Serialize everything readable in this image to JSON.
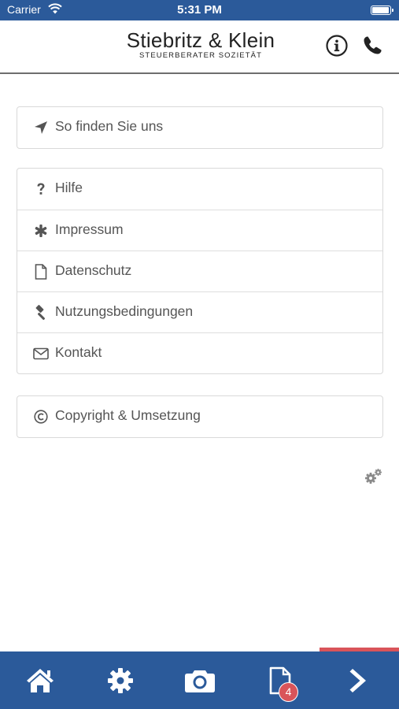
{
  "status_bar": {
    "carrier": "Carrier",
    "time": "5:31 PM",
    "battery_level": 0.95
  },
  "header": {
    "logo_title": "Stiebritz & Klein",
    "logo_subtitle": "STEUERBERATER SOZIETÄT"
  },
  "menu": {
    "group1": [
      {
        "label": "So finden Sie uns",
        "icon": "location-arrow-icon"
      }
    ],
    "group2": [
      {
        "label": "Hilfe",
        "icon": "question-icon"
      },
      {
        "label": "Impressum",
        "icon": "asterisk-icon"
      },
      {
        "label": "Datenschutz",
        "icon": "document-icon"
      },
      {
        "label": "Nutzungsbedingungen",
        "icon": "gavel-icon"
      },
      {
        "label": "Kontakt",
        "icon": "envelope-icon"
      }
    ],
    "group3": [
      {
        "label": "Copyright & Umsetzung",
        "icon": "copyright-icon"
      }
    ]
  },
  "tab_bar": {
    "tabs": [
      "home-icon",
      "gear-icon",
      "camera-icon",
      "document-icon",
      "chevron-right-icon"
    ],
    "document_badge": "4"
  },
  "colors": {
    "brand_blue": "#2b5a9a",
    "accent_red": "#d9545a",
    "text_gray": "#555555"
  }
}
